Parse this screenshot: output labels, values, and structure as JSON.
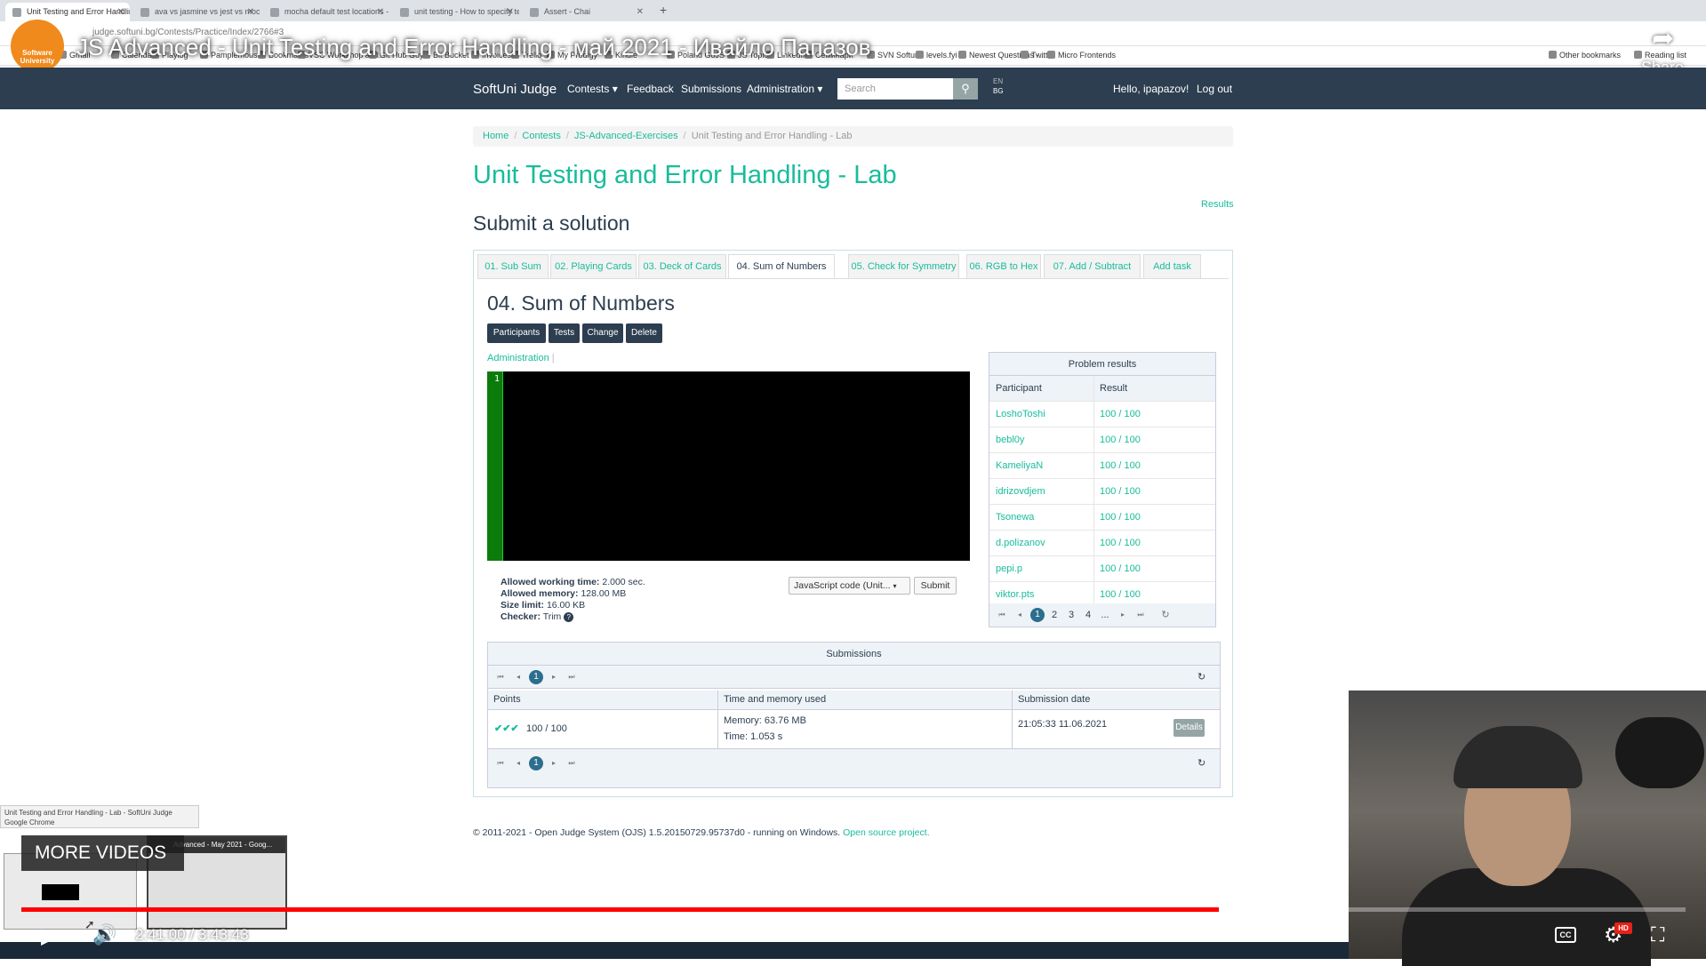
{
  "browser": {
    "tabs": [
      {
        "label": "Unit Testing and Error Handling",
        "active": true
      },
      {
        "label": "ava vs jasmine vs jest vs mocha",
        "active": false
      },
      {
        "label": "mocha default test locations - G",
        "active": false
      },
      {
        "label": "unit testing - How to specify tes",
        "active": false
      },
      {
        "label": "Assert - Chai",
        "active": false
      }
    ],
    "url": "judge.softuni.bg/Contests/Practice/Index/2766#3",
    "bookmarks": [
      "Gmail",
      "Calendar",
      "Playlog",
      "Pamplemousse",
      "Bookmarks",
      "VSC Workshop and...",
      "Git Hub Guy",
      "Bit Bucket",
      "Invoices",
      "Trello",
      "My Prodigy",
      "Kindle",
      "Poland GoJS",
      "JS Topics",
      "LinkedIn",
      "Семинари",
      "SVN Softuni",
      "levels.fyi",
      "Newest Questions -...",
      "Twitter",
      "Micro Frontends",
      "Other bookmarks",
      "Reading list"
    ]
  },
  "youtube": {
    "channel_logo_text": "Software University",
    "video_title": "JS Advanced - Unit Testing and Error Handling - май 2021 - Ивайло Папазов",
    "share_label": "Share",
    "more_videos": "MORE VIDEOS",
    "thumb_tooltip_line1": "Unit Testing and Error Handling - Lab - SoftUni Judge",
    "thumb_tooltip_line2": "Google Chrome",
    "thumb2_caption": "Advanced - May 2021 - Goog...",
    "current_time": "2:41:00",
    "duration": "3:43:43",
    "time_display": "2:41:00 / 3:43:43",
    "played_fraction": 0.7198,
    "buffered_fraction": 0.727,
    "cc_label": "CC",
    "hd_label": "HD"
  },
  "navbar": {
    "brand": "SoftUni Judge",
    "contests": "Contests ▾",
    "feedback": "Feedback",
    "submissions": "Submissions",
    "administration": "Administration ▾",
    "search_placeholder": "Search",
    "lang_en": "EN",
    "lang_bg": "BG",
    "greeting": "Hello, ipapazov!",
    "logout": "Log out"
  },
  "breadcrumb": {
    "home": "Home",
    "contests": "Contests",
    "category": "JS-Advanced-Exercises",
    "current": "Unit Testing and Error Handling - Lab"
  },
  "page": {
    "title": "Unit Testing and Error Handling - Lab",
    "results_link": "Results",
    "submit_heading": "Submit a solution"
  },
  "tasks": {
    "tabs": [
      "01. Sub Sum",
      "02. Playing Cards",
      "03. Deck of Cards",
      "04. Sum of Numbers",
      "05. Check for Symmetry",
      "06. RGB to Hex",
      "07. Add / Subtract",
      "Add task"
    ],
    "active_index": 3,
    "current_title": "04. Sum of Numbers",
    "buttons": {
      "participants": "Participants",
      "tests": "Tests",
      "change": "Change",
      "delete": "Delete"
    },
    "admin_link": "Administration",
    "editor_line": "1",
    "limits": {
      "time_label": "Allowed working time:",
      "time_value": "2.000 sec.",
      "memory_label": "Allowed memory:",
      "memory_value": "128.00 MB",
      "size_label": "Size limit:",
      "size_value": "16.00 KB",
      "checker_label": "Checker:",
      "checker_value": "Trim"
    },
    "language_select": "JavaScript code (Unit...",
    "submit": "Submit"
  },
  "problem_results": {
    "heading": "Problem results",
    "col_participant": "Participant",
    "col_result": "Result",
    "rows": [
      {
        "participant": "LoshoToshi",
        "result": "100 / 100"
      },
      {
        "participant": "bebl0y",
        "result": "100 / 100"
      },
      {
        "participant": "KameliyaN",
        "result": "100 / 100"
      },
      {
        "participant": "idrizovdjem",
        "result": "100 / 100"
      },
      {
        "participant": "Tsonewa",
        "result": "100 / 100"
      },
      {
        "participant": "d.polizanov",
        "result": "100 / 100"
      },
      {
        "participant": "pepi.p",
        "result": "100 / 100"
      },
      {
        "participant": "viktor.pts",
        "result": "100 / 100"
      }
    ],
    "pages": [
      "1",
      "2",
      "3",
      "4",
      "..."
    ],
    "current_page": "1"
  },
  "submissions": {
    "heading": "Submissions",
    "current_page": "1",
    "col_points": "Points",
    "col_time_memory": "Time and memory used",
    "col_date": "Submission date",
    "row": {
      "points": "100 / 100",
      "memory": "Memory: 63.76 MB",
      "time": "Time: 1.053 s",
      "date": "21:05:33 11.06.2021",
      "details": "Details"
    }
  },
  "footer": {
    "text": "© 2011-2021 - Open Judge System (OJS) 1.5.20150729.95737d0 - running on Windows.",
    "link": "Open source project."
  },
  "colors": {
    "accent": "#18bc9c",
    "navbar": "#2c3e50",
    "progress": "#ff0000",
    "editor_gutter": "#0b7c0b"
  }
}
